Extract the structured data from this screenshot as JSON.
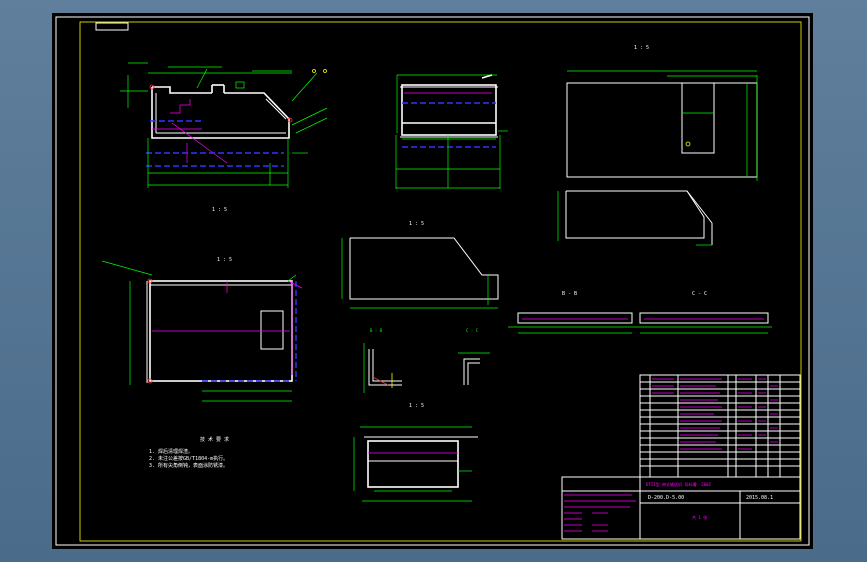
{
  "colors": {
    "background": "#000000",
    "frame": "#ffff00",
    "outline": "#ffffff",
    "dimension": "#00ff00",
    "center_line": "#ff00ff",
    "hidden_line": "#3333ff",
    "section": "#ff3030"
  },
  "drawing": {
    "view_labels": {
      "front": "1 : 5",
      "top": "1 : 5",
      "detail_top_right": "1 : 5",
      "section_b": "B - B",
      "section_c": "C - C",
      "mid_left": "1 : 5",
      "mid_right": "1 : 5",
      "bottom": "1 : 5"
    },
    "notes": {
      "title": "技 术 要 求",
      "items": [
        "1. 焊后清理焊渣。",
        "2. 未注公差按GB/T1804-m执行。",
        "3. 所有尖角倒钝，表面涂防锈漆。"
      ]
    },
    "title_block": {
      "drawing_title": "DTII型 带式输送机 导料槽 -200Z",
      "drawing_no": "D-200.D-5.00",
      "date": "2015.08.1",
      "sheet": "共 1 张"
    }
  }
}
